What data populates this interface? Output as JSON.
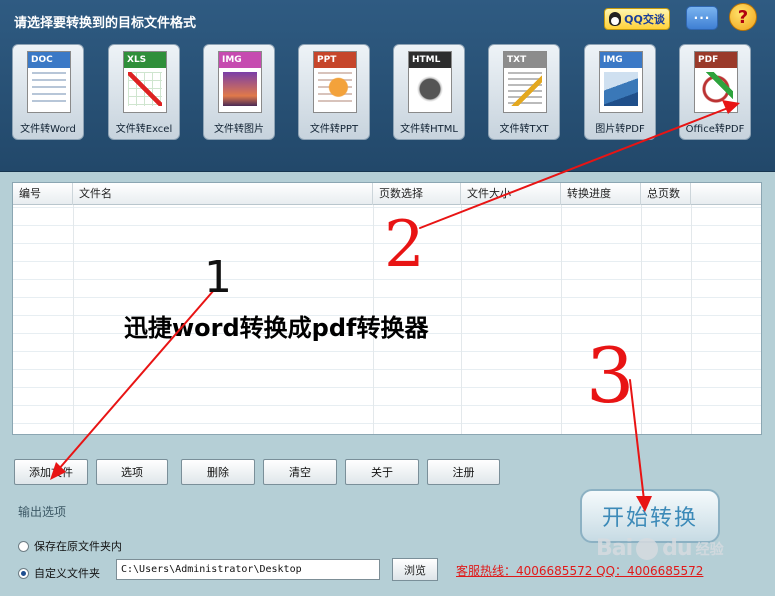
{
  "header": {
    "title": "请选择要转换到的目标文件格式",
    "qq_label": "QQ交谈",
    "chat_glyph": "···",
    "help_glyph": "?"
  },
  "tools": [
    {
      "band": "DOC",
      "band_color": "#3b79c6",
      "label": "文件转Word"
    },
    {
      "band": "XLS",
      "band_color": "#2f8f3a",
      "label": "文件转Excel"
    },
    {
      "band": "IMG",
      "band_color": "#c64bb0",
      "label": "文件转图片"
    },
    {
      "band": "PPT",
      "band_color": "#c6452a",
      "label": "文件转PPT"
    },
    {
      "band": "HTML",
      "band_color": "#2d2d2d",
      "label": "文件转HTML"
    },
    {
      "band": "TXT",
      "band_color": "#8c8c8c",
      "label": "文件转TXT"
    },
    {
      "band": "IMG",
      "band_color": "#3b79c6",
      "label": "图片转PDF"
    },
    {
      "band": "PDF",
      "band_color": "#9a3a2a",
      "label": "Office转PDF"
    }
  ],
  "list": {
    "columns": [
      "编号",
      "文件名",
      "页数选择",
      "文件大小",
      "转换进度",
      "总页数"
    ]
  },
  "overlay": {
    "title": "迅捷word转换成pdf转换器",
    "mark1": "1",
    "mark2": "2",
    "mark3": "3"
  },
  "buttons": {
    "add_file": "添加文件",
    "options": "选项",
    "delete": "删除",
    "clear": "清空",
    "about": "关于",
    "register": "注册",
    "start": "开始转换",
    "browse": "浏览"
  },
  "output": {
    "section_title": "输出选项",
    "save_original": "保存在原文件夹内",
    "custom_folder": "自定义文件夹",
    "path": "C:\\Users\\Administrator\\Desktop"
  },
  "hotline": "客服热线：4006685572 QQ：4006685572",
  "watermark": {
    "logo": "Bai",
    "logo2": "du",
    "sub": "经验"
  },
  "colors": {
    "header_bg": "#2f5b82",
    "body_bg": "#b5cfd6",
    "annotation_red": "#e81414",
    "hotline_red": "#e01a1a"
  }
}
